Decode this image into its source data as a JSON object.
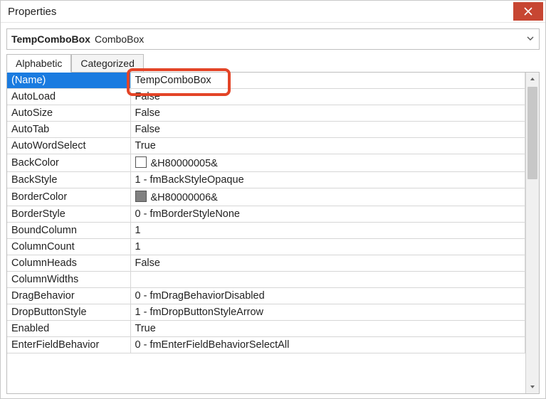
{
  "window": {
    "title": "Properties"
  },
  "object": {
    "name": "TempComboBox",
    "type": "ComboBox"
  },
  "tabs": {
    "alphabetic": "Alphabetic",
    "categorized": "Categorized",
    "active": "alphabetic"
  },
  "colors": {
    "selection": "#1a7be0",
    "close": "#c74632",
    "highlight": "#e34427",
    "swatch_white": "#ffffff",
    "swatch_gray": "#808080"
  },
  "props": [
    {
      "name": "(Name)",
      "value": "TempComboBox",
      "selected": true,
      "highlighted": true
    },
    {
      "name": "AutoLoad",
      "value": "False"
    },
    {
      "name": "AutoSize",
      "value": "False"
    },
    {
      "name": "AutoTab",
      "value": "False"
    },
    {
      "name": "AutoWordSelect",
      "value": "True"
    },
    {
      "name": "BackColor",
      "value": "&H80000005&",
      "swatch": "#ffffff"
    },
    {
      "name": "BackStyle",
      "value": "1 - fmBackStyleOpaque"
    },
    {
      "name": "BorderColor",
      "value": "&H80000006&",
      "swatch": "#808080"
    },
    {
      "name": "BorderStyle",
      "value": "0 - fmBorderStyleNone"
    },
    {
      "name": "BoundColumn",
      "value": "1"
    },
    {
      "name": "ColumnCount",
      "value": "1"
    },
    {
      "name": "ColumnHeads",
      "value": "False"
    },
    {
      "name": "ColumnWidths",
      "value": ""
    },
    {
      "name": "DragBehavior",
      "value": "0 - fmDragBehaviorDisabled"
    },
    {
      "name": "DropButtonStyle",
      "value": "1 - fmDropButtonStyleArrow"
    },
    {
      "name": "Enabled",
      "value": "True"
    },
    {
      "name": "EnterFieldBehavior",
      "value": "0 - fmEnterFieldBehaviorSelectAll"
    }
  ]
}
